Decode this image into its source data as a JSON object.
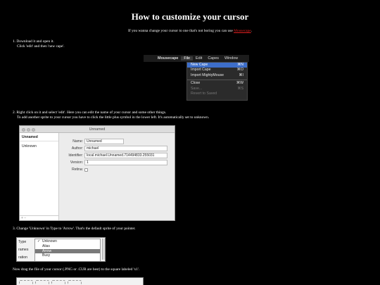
{
  "page": {
    "title": "How to customize your cursor",
    "intro_text": "If you wanna change your cursor to one that's not boring you can use ",
    "intro_link": "Mousecape",
    "intro_end": "."
  },
  "step1": {
    "line1": "1. Download it and open it.",
    "line2": "Click 'edit' and then 'new cape'.",
    "menubar": {
      "apple": "",
      "items": [
        "Mousecape",
        "File",
        "Edit",
        "Capes",
        "Window"
      ]
    },
    "menu_items": [
      {
        "label": "New Cape",
        "shortcut": "⌘N"
      },
      {
        "label": "Import Cape",
        "shortcut": "⌘O"
      },
      {
        "label": "Import MightyMouse",
        "shortcut": "⌘I"
      },
      {
        "label": "Close",
        "shortcut": "⌘W"
      },
      {
        "label": "Save...",
        "shortcut": "⌘S"
      },
      {
        "label": "Revert to Saved",
        "shortcut": ""
      }
    ]
  },
  "step2": {
    "line1": "2. Right click on it and select 'edit'. Here you can edit the name of your cursor and some other things.",
    "line2": "To add another sprite to your cursor you have to click the little plus symbol in the lower left. It's automatically set to unknown.",
    "window_title": "Unnamed",
    "sidebar_header": "Unnamed",
    "sidebar_row": "Unknown",
    "sidebar_footer": "+  −",
    "fields": {
      "name_label": "Name:",
      "name_value": "Unnamed",
      "author_label": "Author:",
      "author_value": "michael",
      "identifier_label": "Identifier:",
      "identifier_value": "local.michael.Unnamed.714494833.255031",
      "version_label": "Version:",
      "version_value": "1",
      "retina_label": "Retina:"
    }
  },
  "step3": {
    "line1": "3. Change 'Unknown' in Type to 'Arrow'. That's the default sprite of your pointer.",
    "type_label": "Type",
    "frames_label": "rames",
    "duration_label": "ration",
    "options": [
      "Unknown",
      "Alias",
      "Arrow",
      "Busy"
    ],
    "checked_option": "✓",
    "line2": "Now drag the file of your cursor (.PNG or .CUR are best) to the square labeled 'x1'."
  }
}
